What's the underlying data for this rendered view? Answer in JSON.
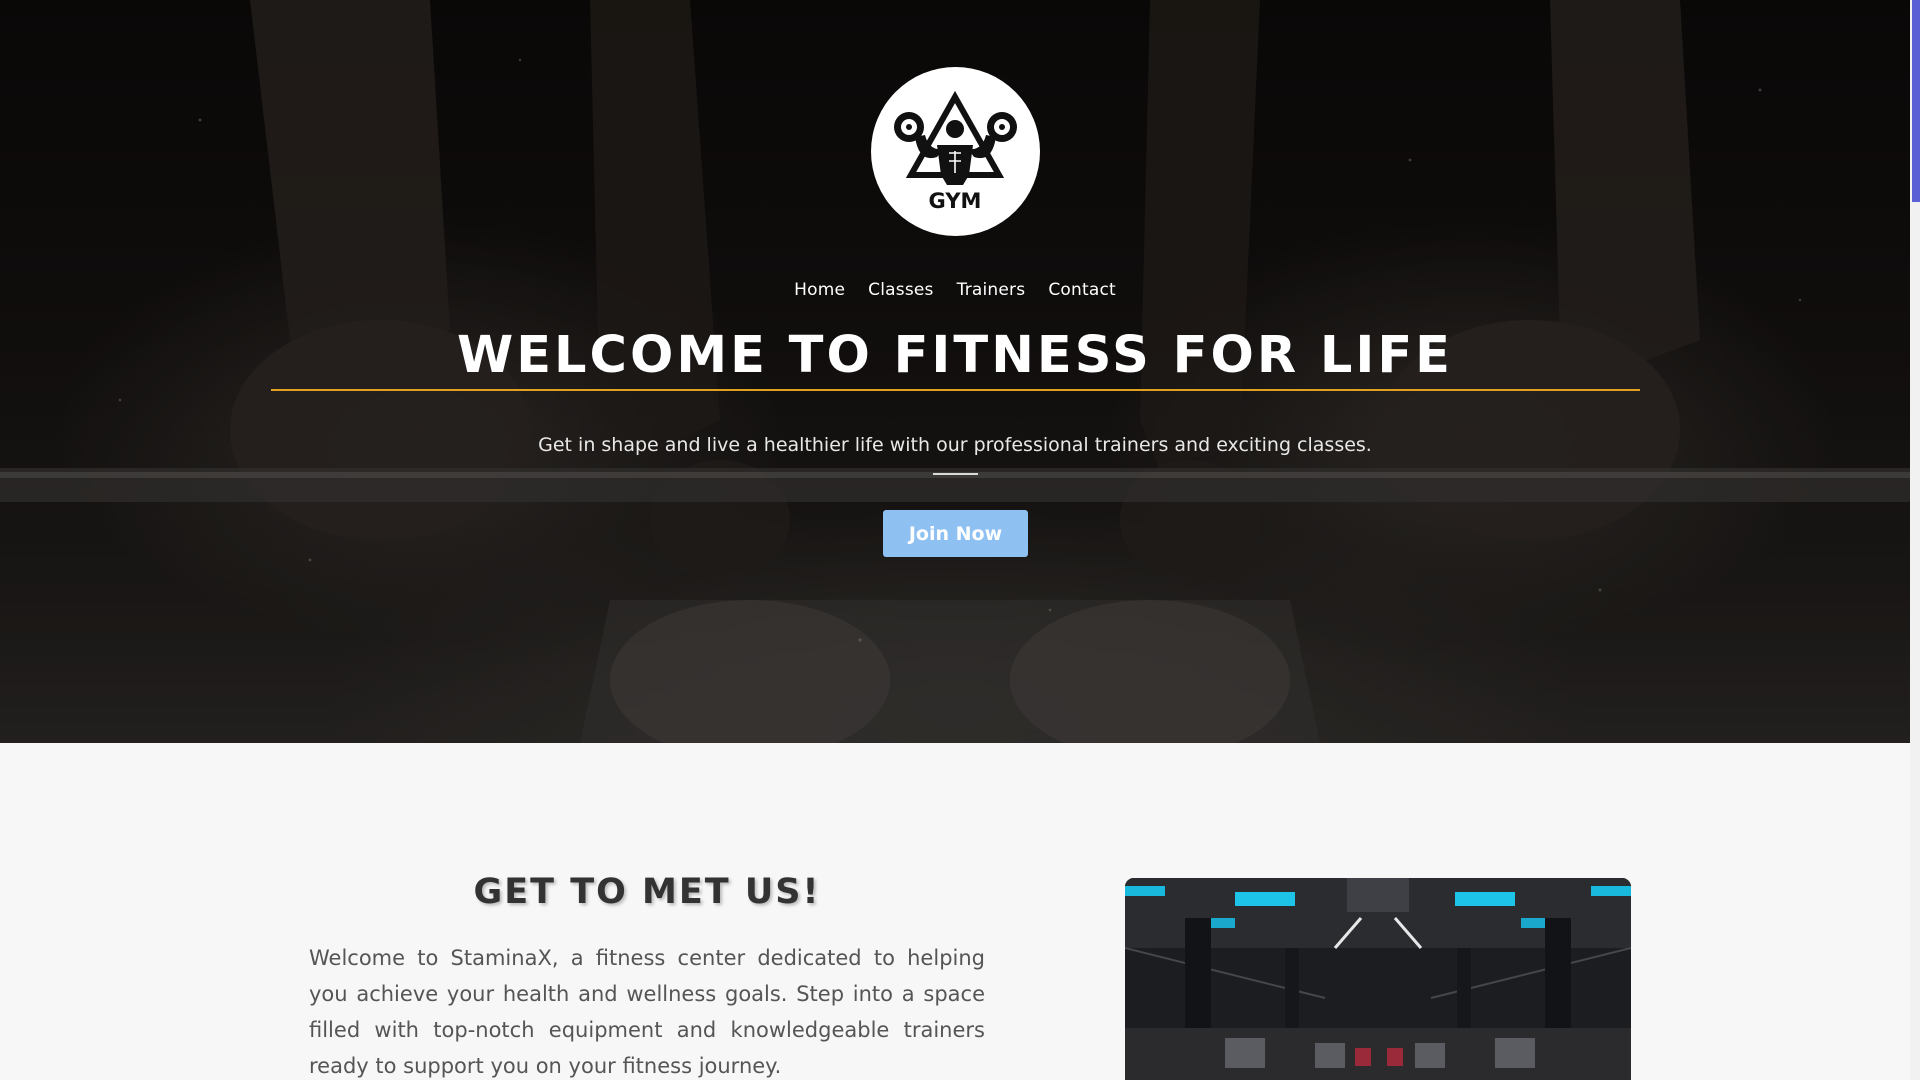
{
  "logo": {
    "text": "GYM",
    "icon": "gym-logo-icon"
  },
  "nav": {
    "items": [
      {
        "label": "Home"
      },
      {
        "label": "Classes"
      },
      {
        "label": "Trainers"
      },
      {
        "label": "Contact"
      }
    ]
  },
  "hero": {
    "title": "WELCOME TO FITNESS FOR LIFE",
    "subtitle": "Get in shape and live a healthier life with our professional trainers and exciting classes.",
    "button_label": "Join Now",
    "accent_color": "#e0a120",
    "button_color": "#8ec1f2"
  },
  "about": {
    "title": "GET TO MET US!",
    "text": "Welcome to StaminaX, a fitness center dedicated to helping you achieve your health and wellness goals. Step into a space filled with top-notch equipment and knowledgeable trainers ready to support you on your fitness journey."
  },
  "scrollbar": {
    "thumb_color": "#5a5fd6"
  }
}
